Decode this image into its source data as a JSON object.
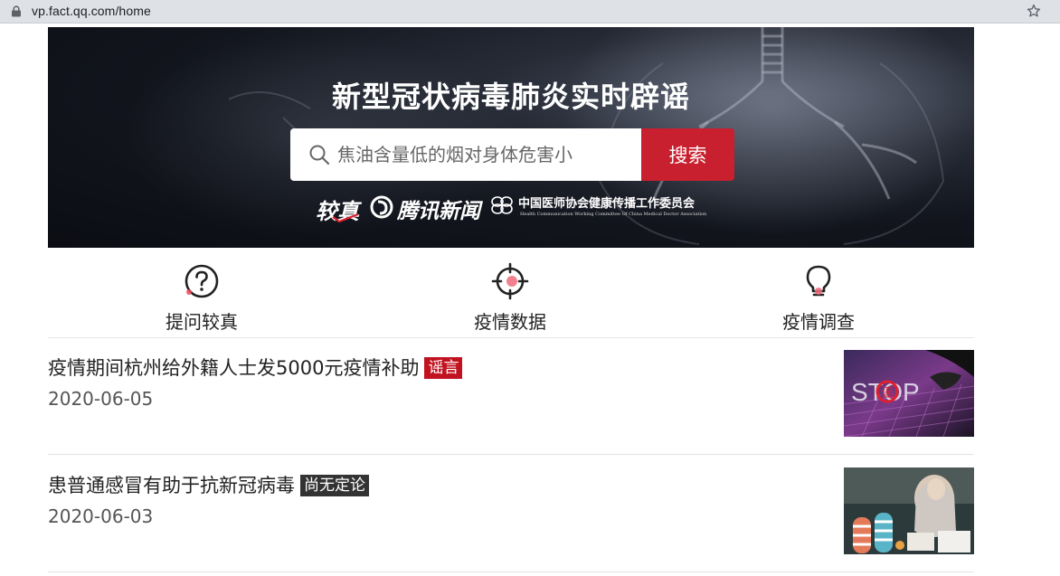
{
  "browser": {
    "url": "vp.fact.qq.com/home"
  },
  "hero": {
    "title": "新型冠状病毒肺炎实时辟谣",
    "search_placeholder": "焦油含量低的烟对身体危害小",
    "search_button": "搜索",
    "logo_jiaozhen": "较真",
    "logo_tencent": "腾讯新闻",
    "logo_assoc_cn": "中国医师协会健康传播工作委员会",
    "logo_assoc_en": "Health Communication Working Committee Of China Medical Doctor Association"
  },
  "nav": {
    "items": [
      {
        "label": "提问较真",
        "icon": "question-icon"
      },
      {
        "label": "疫情数据",
        "icon": "crosshair-icon"
      },
      {
        "label": "疫情调查",
        "icon": "lightbulb-icon"
      }
    ]
  },
  "articles": [
    {
      "title": "疫情期间杭州给外籍人士发5000元疫情补助",
      "badge": "谣言",
      "badge_color": "#c1121f",
      "date": "2020-06-05",
      "thumb_text": "STOP",
      "thumb_stamp": "谣"
    },
    {
      "title": "患普通感冒有助于抗新冠病毒",
      "badge": "尚无定论",
      "badge_color": "#333333",
      "date": "2020-06-03"
    }
  ],
  "colors": {
    "accent": "#c8202f",
    "hero_bg": "#0b0d13"
  }
}
